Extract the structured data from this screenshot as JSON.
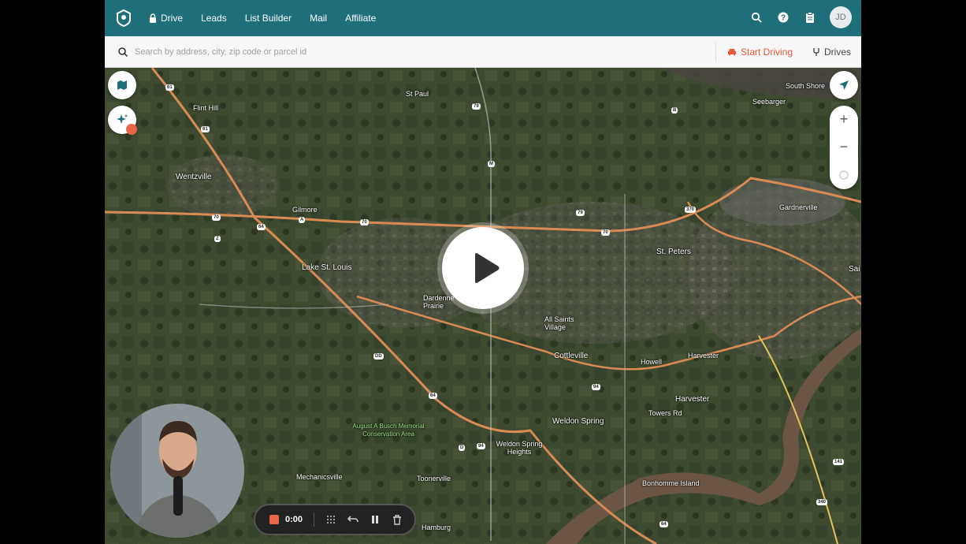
{
  "nav": {
    "items": [
      {
        "label": "Drive",
        "icon": "lock-icon"
      },
      {
        "label": "Leads"
      },
      {
        "label": "List Builder"
      },
      {
        "label": "Mail"
      },
      {
        "label": "Affiliate"
      }
    ],
    "avatar_initials": "JD"
  },
  "search": {
    "placeholder": "Search by address, city, zip code or parcel id",
    "start_driving_label": "Start Driving",
    "drives_label": "Drives"
  },
  "map": {
    "labels": {
      "st_paul": "St Paul",
      "south_shore": "South Shore",
      "seebarger": "Seebarger",
      "flint_hill": "Flint Hill",
      "wentzville": "Wentzville",
      "gilmore": "Gilmore",
      "gardnerville": "Gardnerville",
      "lake_st_louis": "Lake St. Louis",
      "st_peters": "St. Peters",
      "dardenne_prairie": "Dardenne Prairie",
      "all_saints_village": "All Saints Village",
      "cottleville": "Cottleville",
      "harvester": "Harvester",
      "weldon_spring": "Weldon Spring",
      "weldon_spring_heights": "Weldon Spring Heights",
      "busch_area": "August A Busch Memorial Conservation Area",
      "mechanicsville": "Mechanicsville",
      "toonerville": "Toonerville",
      "bonhomme_island": "Bonhomme Island",
      "hamburg": "Hamburg",
      "howell": "Howell",
      "towers_rd": "Towers Rd",
      "sai": "Sai"
    },
    "shields": [
      "61",
      "61",
      "79",
      "M",
      "70",
      "70",
      "A",
      "Z",
      "64",
      "79",
      "70",
      "370",
      "B",
      "DD",
      "64",
      "94",
      "D",
      "94",
      "141",
      "340",
      "64"
    ]
  },
  "recorder": {
    "time": "0:00"
  },
  "colors": {
    "header": "#1f6f7a",
    "accent": "#e85a3c"
  }
}
